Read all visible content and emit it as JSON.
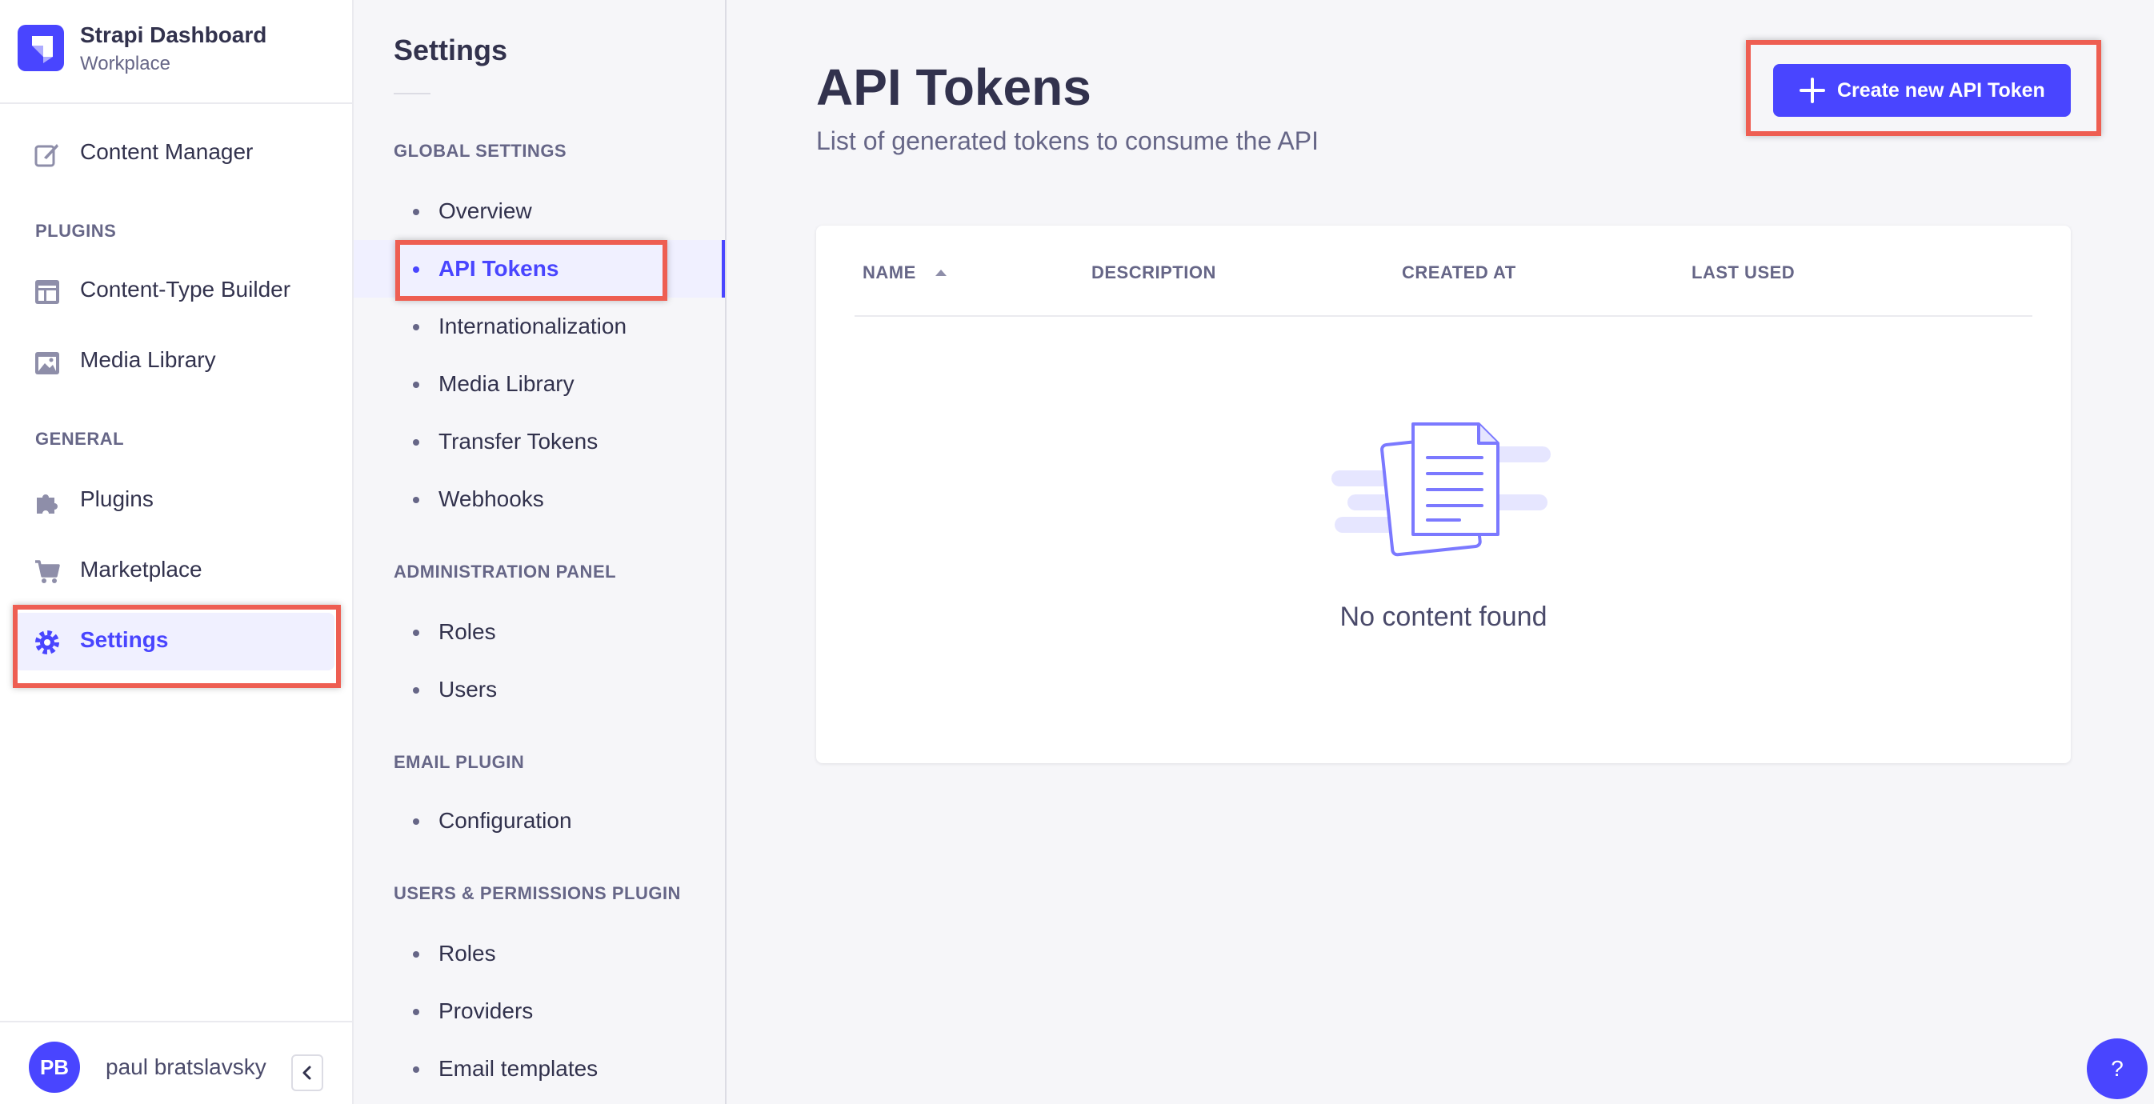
{
  "brand": {
    "title": "Strapi Dashboard",
    "subtitle": "Workplace",
    "logo_icon": "strapi-logo-icon"
  },
  "mainnav": {
    "top_items": [
      {
        "label": "Content Manager",
        "icon": "feather-pen-icon"
      }
    ],
    "plugins_label": "PLUGINS",
    "plugin_items": [
      {
        "label": "Content-Type Builder",
        "icon": "layout-icon"
      },
      {
        "label": "Media Library",
        "icon": "image-icon"
      }
    ],
    "general_label": "GENERAL",
    "general_items": [
      {
        "label": "Plugins",
        "icon": "puzzle-icon"
      },
      {
        "label": "Marketplace",
        "icon": "cart-icon"
      },
      {
        "label": "Settings",
        "icon": "gear-icon",
        "active": true
      }
    ]
  },
  "user": {
    "initials": "PB",
    "name": "paul bratslavsky"
  },
  "subnav": {
    "title": "Settings",
    "sections": [
      {
        "label": "GLOBAL SETTINGS",
        "items": [
          "Overview",
          "API Tokens",
          "Internationalization",
          "Media Library",
          "Transfer Tokens",
          "Webhooks"
        ]
      },
      {
        "label": "ADMINISTRATION PANEL",
        "items": [
          "Roles",
          "Users"
        ]
      },
      {
        "label": "EMAIL PLUGIN",
        "items": [
          "Configuration"
        ]
      },
      {
        "label": "USERS & PERMISSIONS PLUGIN",
        "items": [
          "Roles",
          "Providers",
          "Email templates"
        ]
      }
    ],
    "active_item": "API Tokens"
  },
  "main": {
    "title": "API Tokens",
    "subtitle": "List of generated tokens to consume the API",
    "create_button": "Create new API Token",
    "table": {
      "columns": [
        "NAME",
        "DESCRIPTION",
        "CREATED AT",
        "LAST USED"
      ],
      "rows": [],
      "empty_text": "No content found"
    }
  },
  "help_label": "?",
  "colors": {
    "accent": "#4945ff",
    "highlight": "#ee5e52",
    "text": "#32324d",
    "muted": "#666687"
  }
}
